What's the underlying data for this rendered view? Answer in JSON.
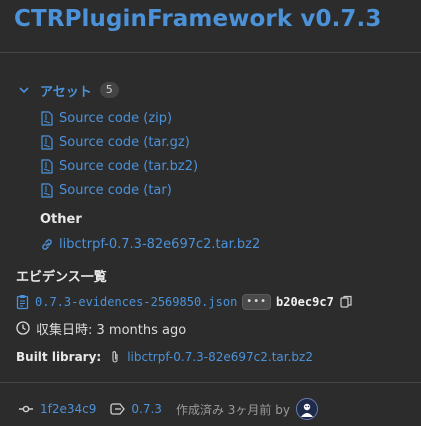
{
  "release": {
    "title": "CTRPluginFramework v0.7.3"
  },
  "assets": {
    "label": "アセット",
    "count": "5",
    "items": [
      {
        "label": "Source code (zip)",
        "icon": "file-zip-icon"
      },
      {
        "label": "Source code (tar.gz)",
        "icon": "file-zip-icon"
      },
      {
        "label": "Source code (tar.bz2)",
        "icon": "file-zip-icon"
      },
      {
        "label": "Source code (tar)",
        "icon": "file-zip-icon"
      }
    ],
    "other_heading": "Other",
    "other_link": "libctrpf-0.7.3-82e697c2.tar.bz2"
  },
  "evidence": {
    "heading": "エビデンス一覧",
    "file": "0.7.3-evidences-2569850.json",
    "dots": "•••",
    "hash": "b20ec9c7",
    "collected": "収集日時: 3 months ago",
    "built_label": "Built library:",
    "built_link": "libctrpf-0.7.3-82e697c2.tar.bz2"
  },
  "footer": {
    "commit": "1f2e34c9",
    "tag": "0.7.3",
    "created": "作成済み 3ヶ月前 by"
  },
  "colors": {
    "background": "#2c2c2c",
    "link": "#4b92d9",
    "divider": "#454545"
  }
}
